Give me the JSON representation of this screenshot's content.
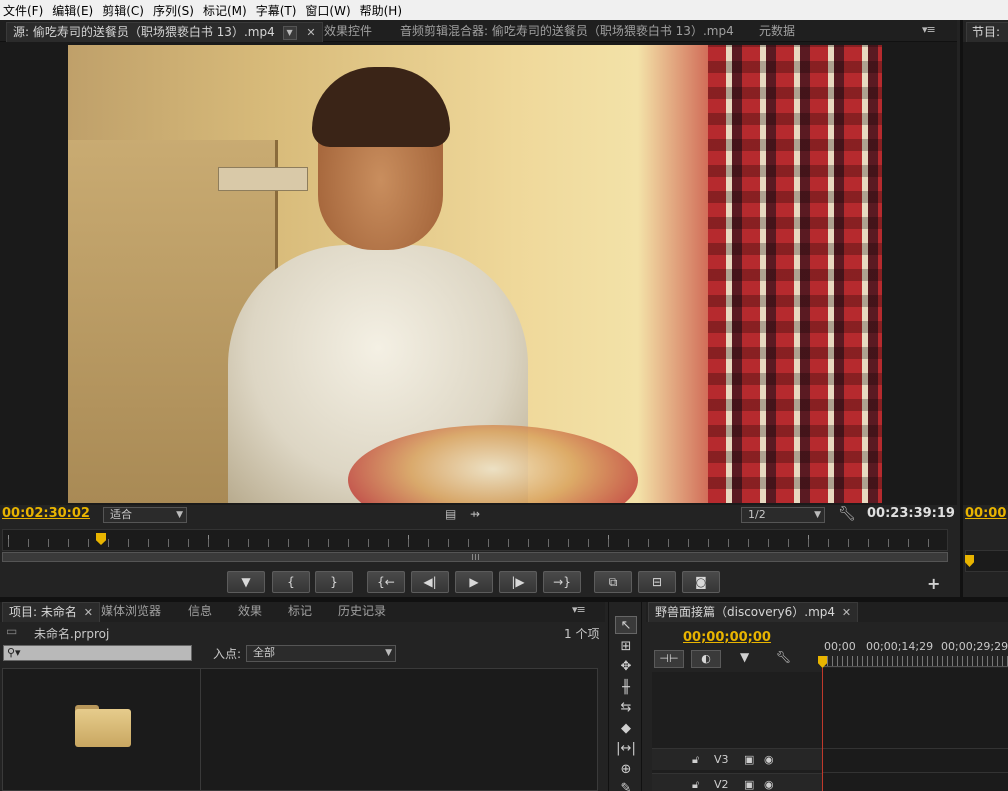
{
  "menu": [
    "文件(F)",
    "编辑(E)",
    "剪辑(C)",
    "序列(S)",
    "标记(M)",
    "字幕(T)",
    "窗口(W)",
    "帮助(H)"
  ],
  "source_monitor": {
    "tabs": {
      "source": "源: 偷吃寿司的送餐员（职场猥亵白书 13）.mp4",
      "effect_controls": "效果控件",
      "audio_mixer": "音频剪辑混合器: 偷吃寿司的送餐员（职场猥亵白书 13）.mp4",
      "metadata": "元数据"
    },
    "current_timecode": "00:02:30:02",
    "zoom_select": "适合",
    "resolution_select": "1/2",
    "duration_timecode": "00:23:39:19",
    "playhead_fraction": 0.105,
    "transport": {
      "add_marker": "add-marker-icon",
      "mark_in": "{",
      "mark_out": "}",
      "go_to_in": "{←",
      "step_back": "◀|",
      "play": "▶",
      "step_forward": "|▶",
      "go_to_out": "→}",
      "insert": "insert-icon",
      "overwrite": "overwrite-icon",
      "export_frame": "camera-icon",
      "add_button": "+"
    }
  },
  "program_monitor": {
    "tab": "节目:",
    "timecode": "00:00"
  },
  "project_panel": {
    "tabs": {
      "project": "项目: 未命名",
      "media_browser": "媒体浏览器",
      "info": "信息",
      "effects": "效果",
      "markers": "标记",
      "history": "历史记录"
    },
    "file_name": "未命名.prproj",
    "item_count": "1 个项",
    "search_placeholder": "",
    "in_point_label": "入点:",
    "in_point_value": "全部"
  },
  "tools": [
    "selection-icon",
    "track-select-icon",
    "ripple-edit-icon",
    "rolling-edit-icon",
    "rate-stretch-icon",
    "razor-icon",
    "slip-icon",
    "slide-icon",
    "pen-icon"
  ],
  "timeline": {
    "tab": "野兽面接篇（discovery6）.mp4",
    "timecode": "00;00;00;00",
    "ruler_labels": [
      "00;00",
      "00;00;14;29",
      "00;00;29;29"
    ],
    "tracks": [
      {
        "name": "V3"
      },
      {
        "name": "V2"
      }
    ]
  },
  "colors": {
    "timecode": "#e8b400",
    "playhead_line": "#c0392b",
    "panel_bg": "#232323"
  }
}
